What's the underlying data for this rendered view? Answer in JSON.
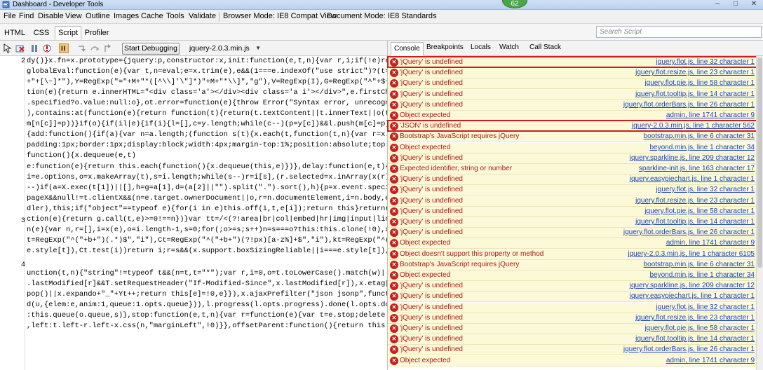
{
  "window": {
    "title": "Dashboard - Developer Tools",
    "badge": "62",
    "min": "–",
    "max": "□",
    "close": "✕"
  },
  "menu": [
    "File",
    "Find",
    "Disable",
    "View",
    "Outline",
    "Images",
    "Cache",
    "Tools",
    "Validate",
    "Browser Mode: IE8 Compat View",
    "Document Mode: IE8 Standards"
  ],
  "tabs": [
    "HTML",
    "CSS",
    "Script",
    "Profiler"
  ],
  "active_tab": "Script",
  "search": {
    "placeholder": "Search Script"
  },
  "toolbar": {
    "start_debugging": "Start Debugging",
    "script_file": "jquery-2.0.3.min.js",
    "dropdown": "▼"
  },
  "right_tabs": [
    "Console",
    "Breakpoints",
    "Locals",
    "Watch",
    "Call Stack"
  ],
  "active_right_tab": "Console",
  "gutter": [
    "2",
    "3",
    "4"
  ],
  "code_lines": [
    "dy()}x.fn=x.prototype={jquery:p,constructor:x,init:function(e,t,n){var r,i;if(!e)return t",
    "globalEval:function(e){var t,n=eval;e=x.trim(e),e&&(1===e.indexOf(\"use strict\")?(t=o.creat",
    "+\"+[\\~]*\"),Y=RegExp(\"=\"+M+\"*([^\\\\]'\\\"]*)\"+M+\"*\\\\]\",\"g\"),V=RegExp(I),G=RegExp(\"^\"+$+\"$\"),J={",
    "tion(e){return e.innerHTML=\"<div class='a'></div><div class='a i'></div>\",e.firstChild.cla",
    ".specified?o.value:null:o},ot.error=function(e){throw Error(\"Syntax error, unrecognized ex",
    "),contains:at(function(e){return function(t){return(t.textContent||t.innerText||o(t)).inde",
    "m[n[c]]=p))}if(o){if(il|e){if(i){l=[],c=y.length;while(c--)(p=y[c])&&l.push(m[c]=p);if(null",
    "{add:function(){if(a){var n=a.length;(function s(t){x.each(t,function(t,n){var r=x.type(n)",
    "padding:1px;border:1px;display:block;width:4px;margin-top:1%;position:absolute;top:1%\",x.s",
    "function(){x.dequeue(e,t)",
    "e:function(e){return this.each(function(){x.dequeue(this,e)})},delay:function(e,t){return",
    "i=e.options,o=x.makeArray(t),s=i.length;while(s--)r=i[s],(r.selected=x.inArray(x(r).val(),",
    "--)if(a=X.exec(t[1])||[],h=g=a[1],d=(a[2]||\"\").split(\".\").sort(),h){p=x.event.special[h]|",
    "pageX&&null!=t.clientX&&(n=e.target.ownerDocument||o,r=n.documentElement,i=n.body,e.pageX",
    "dler),this;if(\"object\"==typeof e){for(i in e)this.off(i,t,e[i]);return this}return(t===!1|",
    "ction(e){return g.call(t,e)>=0!==n})}var tt=/<(?!area|br|col|embed|hr|img|input|link|meta|",
    "n(e){var n,r=[],i=x(e),o=i.length-1,s=0;for(;o>=s;s++)n=s===o?this:this.clone(!0),x(i[s])[",
    "t=RegExp(\"^(\"+b+\")(.*)$\",\"i\"),Ct=RegExp(\"^(\"+b+\")(?!px)[a-z%]+$\",\"i\"),kt=RegExp(\"^([+-])=(",
    "e.style[t]),Ct.test(i))return i;r=s&&(x.support.boxSizingReliable||i===e.style[t]),i=parseF",
    "unction(t,n){\"string\"!=typeof t&&(n=t,t=\"*\");var r,i=0,o=t.toLowerCase().match(w)||[];if(x",
    ".lastModified[r]&&T.setRequestHeader(\"If-Modified-Since\",x.lastModified[r]),x.etag[r]&&T.s",
    "pop()||x.expando+\"_\"+Yt++;return this[e]=!0,e}}),x.ajaxPrefilter(\"json jsonp\",function(t,n",
    "d(u,{elem:e,anim:1,queue:1.opts.queue})),l.progress(l.opts.progress).done(l.opts.done,l.op",
    ":this.queue(o.queue,s)},stop:function(e,t,n){var r=function(e){var t=e.stop;delete e.stop,",
    ",left:t.left-r.left-x.css(n,\"marginLeft\",!0)}},offsetParent:function(){return this.map(fu"
  ],
  "console": [
    {
      "msg": "'jQuery' is undefined",
      "src": "jquery.flot.js, line 32 character 1"
    },
    {
      "msg": "'jQuery' is undefined",
      "src": "jquery.flot.resize.js, line 23 character 1"
    },
    {
      "msg": "'jQuery' is undefined",
      "src": "jquery.flot.pie.js, line 58 character 1"
    },
    {
      "msg": "'jQuery' is undefined",
      "src": "jquery.flot.tooltip.js, line 14 character 1"
    },
    {
      "msg": "'jQuery' is undefined",
      "src": "jquery.flot.orderBars.js, line 26 character 1"
    },
    {
      "msg": "Object expected",
      "src": "admin, line 1741 character 9"
    },
    {
      "msg": "'JSON' is undefined",
      "src": "jquery-2.0.3.min.js, line 1 character 562"
    },
    {
      "msg": "Bootstrap's JavaScript requires jQuery",
      "src": "bootstrap.min.js, line 6 character 31"
    },
    {
      "msg": "Object expected",
      "src": "beyond.min.js, line 1 character 34"
    },
    {
      "msg": "'jQuery' is undefined",
      "src": "jquery.sparkline.js, line 209 character 12"
    },
    {
      "msg": "Expected identifier, string or number",
      "src": "sparkline-init.js, line 163 character 17"
    },
    {
      "msg": "'jQuery' is undefined",
      "src": "jquery.easypiechart.js, line 1 character 1"
    },
    {
      "msg": "'jQuery' is undefined",
      "src": "jquery.flot.js, line 32 character 1"
    },
    {
      "msg": "'jQuery' is undefined",
      "src": "jquery.flot.resize.js, line 23 character 1"
    },
    {
      "msg": "'jQuery' is undefined",
      "src": "jquery.flot.pie.js, line 58 character 1"
    },
    {
      "msg": "'jQuery' is undefined",
      "src": "jquery.flot.tooltip.js, line 14 character 1"
    },
    {
      "msg": "'jQuery' is undefined",
      "src": "jquery.flot.orderBars.js, line 26 character 1"
    },
    {
      "msg": "Object expected",
      "src": "admin, line 1741 character 9"
    },
    {
      "msg": "Object doesn't support this property or method",
      "src": "jquery-2.0.3.min.js, line 1 character 6105"
    },
    {
      "msg": "Bootstrap's JavaScript requires jQuery",
      "src": "bootstrap.min.js, line 6 character 31"
    },
    {
      "msg": "Object expected",
      "src": "beyond.min.js, line 1 character 34"
    },
    {
      "msg": "'jQuery' is undefined",
      "src": "jquery.sparkline.js, line 209 character 12"
    },
    {
      "msg": "'jQuery' is undefined",
      "src": "jquery.easypiechart.js, line 1 character 1"
    },
    {
      "msg": "'jQuery' is undefined",
      "src": "jquery.flot.js, line 32 character 1"
    },
    {
      "msg": "'jQuery' is undefined",
      "src": "jquery.flot.resize.js, line 23 character 1"
    },
    {
      "msg": "'jQuery' is undefined",
      "src": "jquery.flot.pie.js, line 58 character 1"
    },
    {
      "msg": "'jQuery' is undefined",
      "src": "jquery.flot.tooltip.js, line 14 character 1"
    },
    {
      "msg": "'jQuery' is undefined",
      "src": "jquery.flot.orderBars.js, line 26 character 1"
    },
    {
      "msg": "Object expected",
      "src": "admin, line 1741 character 9"
    }
  ],
  "highlighted_rows": [
    0,
    6
  ],
  "colors": {
    "error_bg": "#fbf9d7",
    "error_text": "#b01818",
    "link": "#1a44c0",
    "highlight": "#d11c1c"
  },
  "icons": [
    "error-icon",
    "select-element-icon",
    "clear-browser-cache-icon",
    "break-all-icon",
    "break-on-error-icon",
    "step-into-icon",
    "step-over-icon",
    "step-out-icon",
    "continue-icon"
  ]
}
